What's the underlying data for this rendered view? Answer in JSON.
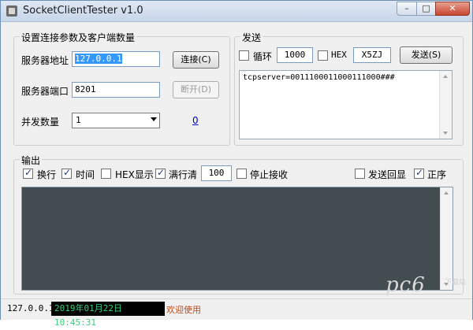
{
  "window": {
    "title": "SocketClientTester v1.0",
    "minimize_glyph": "–",
    "maximize_glyph": "□",
    "close_glyph": "✕"
  },
  "connection": {
    "group_title": "设置连接参数及客户端数量",
    "server_address_label": "服务器地址",
    "server_address_value": "127.0.0.1",
    "server_port_label": "服务器端口",
    "server_port_value": "8201",
    "concurrency_label": "并发数量",
    "concurrency_value": "1",
    "connect_button": "连接(C)",
    "disconnect_button": "断开(D)",
    "connected_count": "0"
  },
  "send": {
    "group_title": "发送",
    "loop_label": "循环",
    "loop_checked": false,
    "loop_interval": "1000",
    "hex_label": "HEX",
    "hex_checked": false,
    "code_value": "X5ZJ",
    "send_button": "发送(S)",
    "content": "tcpserver=0011100011000111000###"
  },
  "output": {
    "group_title": "输出",
    "options": [
      {
        "label": "换行",
        "checked": true
      },
      {
        "label": "时间",
        "checked": true
      },
      {
        "label": "HEX显示",
        "checked": false
      },
      {
        "label": "满行清",
        "checked": true
      },
      {
        "label": "停止接收",
        "checked": false
      },
      {
        "label": "发送回显",
        "checked": false
      },
      {
        "label": "正序",
        "checked": true
      }
    ],
    "line_clear_count": "100",
    "background_color": "#434c51"
  },
  "status": {
    "ip": "127.0.0.1",
    "datetime": "2019年01月22日 10:45:31",
    "message": "欢迎使用"
  },
  "watermark": {
    "logo_text": "pc6",
    "sub_text": "下载站"
  },
  "colors": {
    "accent": "#3399ff",
    "status_time_fg": "#33d17a",
    "welcome_fg": "#c24a1a",
    "link": "#0000cc"
  }
}
